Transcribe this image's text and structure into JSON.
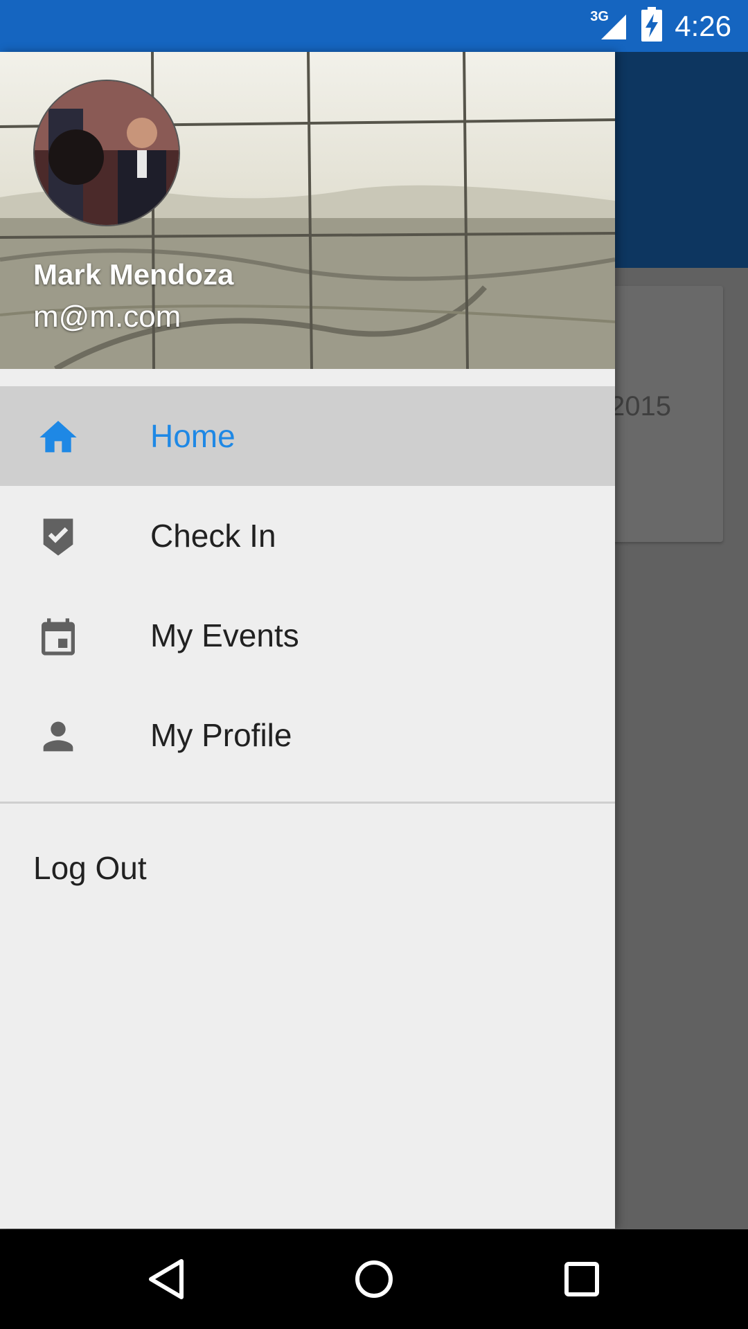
{
  "status_bar": {
    "network": "3G",
    "time": "4:26",
    "icons": [
      "signal-icon",
      "battery-charging-icon"
    ]
  },
  "background": {
    "card_text": "2015"
  },
  "drawer": {
    "user": {
      "name": "Mark Mendoza",
      "email": "m@m.com"
    },
    "items": [
      {
        "label": "Home",
        "icon": "home-icon",
        "active": true
      },
      {
        "label": "Check In",
        "icon": "check-shield-icon",
        "active": false
      },
      {
        "label": "My Events",
        "icon": "calendar-icon",
        "active": false
      },
      {
        "label": "My Profile",
        "icon": "person-icon",
        "active": false
      }
    ],
    "logout_label": "Log Out"
  },
  "nav_bar": {
    "buttons": [
      "back-icon",
      "home-circle-icon",
      "recents-icon"
    ]
  },
  "colors": {
    "status_bar": "#1565c0",
    "accent": "#1e88e5",
    "drawer_bg": "#eeeeee",
    "active_bg": "#cfcfcf"
  }
}
